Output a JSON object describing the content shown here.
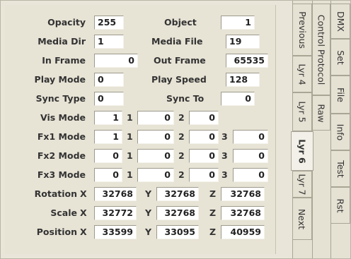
{
  "opacity": {
    "label": "Opacity",
    "value": "255"
  },
  "object": {
    "label": "Object",
    "value": "1"
  },
  "media_dir": {
    "label": "Media Dir",
    "value": "1"
  },
  "media_file": {
    "label": "Media File",
    "value": "19"
  },
  "in_frame": {
    "label": "In Frame",
    "value": "0"
  },
  "out_frame": {
    "label": "Out Frame",
    "value": "65535"
  },
  "play_mode": {
    "label": "Play Mode",
    "value": "0"
  },
  "play_speed": {
    "label": "Play Speed",
    "value": "128"
  },
  "sync_type": {
    "label": "Sync Type",
    "value": "0"
  },
  "sync_to": {
    "label": "Sync To",
    "value": "0"
  },
  "vis_mode": {
    "label": "Vis Mode",
    "values": [
      "1",
      "0",
      "0"
    ]
  },
  "fx1_mode": {
    "label": "Fx1 Mode",
    "values": [
      "1",
      "0",
      "0",
      "0"
    ]
  },
  "fx2_mode": {
    "label": "Fx2 Mode",
    "values": [
      "0",
      "0",
      "0",
      "0"
    ]
  },
  "fx3_mode": {
    "label": "Fx3 Mode",
    "values": [
      "0",
      "0",
      "0",
      "0"
    ]
  },
  "slot_labels": [
    "1",
    "2",
    "3"
  ],
  "rotation": {
    "label": "Rotation",
    "x": "32768",
    "y": "32768",
    "z": "32768"
  },
  "scale": {
    "label": "Scale",
    "x": "32772",
    "y": "32768",
    "z": "32768"
  },
  "position": {
    "label": "Position",
    "x": "33599",
    "y": "33095",
    "z": "40959"
  },
  "axis_labels": {
    "x": "X",
    "y": "Y",
    "z": "Z"
  },
  "tabs_inner": [
    "Previous",
    "Lyr 4",
    "Lyr 5",
    "Lyr 6",
    "Lyr 7",
    "Next"
  ],
  "tabs_middle": [
    "Control Protocol",
    "Raw"
  ],
  "tabs_outer": [
    "DMX",
    "Set",
    "File",
    "Info",
    "Test",
    "Rst"
  ],
  "active_tab": "Lyr 6"
}
